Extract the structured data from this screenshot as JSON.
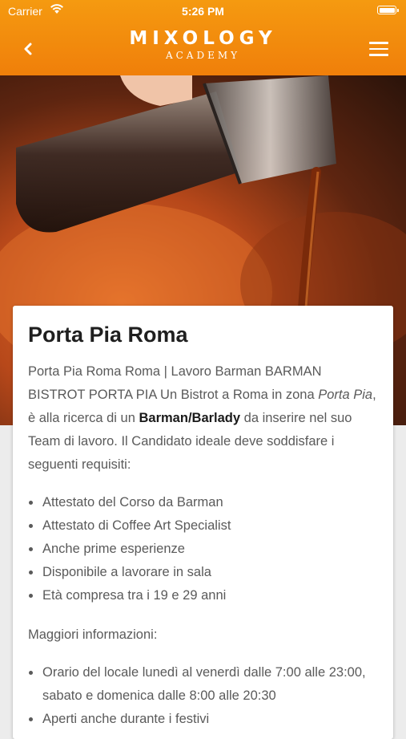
{
  "status_bar": {
    "carrier": "Carrier",
    "time": "5:26 PM"
  },
  "header": {
    "logo_main": "MIXOLOGY",
    "logo_sub": "ACADEMY",
    "back_icon": "chevron-left-icon",
    "menu_icon": "hamburger-menu-icon"
  },
  "colors": {
    "header": "#f0800a",
    "accent_text": "#1a1a1a"
  },
  "article": {
    "title": "Porta Pia Roma",
    "intro_part1": "Porta Pia Roma Roma | Lavoro Barman BARMAN BISTROT PORTA  PIA Un Bistrot a Roma in zona ",
    "intro_italic": "Porta Pia",
    "intro_part2": ", è alla ricerca di un ",
    "intro_bold": "Barman/Barlady",
    "intro_part3": " da inserire nel suo Team di lavoro. Il Candidato ideale deve soddisfare i seguenti requisiti:",
    "requirements": [
      "Attestato del Corso da Barman",
      "Attestato di Coffee Art Specialist",
      "Anche prime esperienze",
      "Disponibile a lavorare in sala",
      "Età compresa tra i 19 e 29 anni"
    ],
    "more_info_heading": "Maggiori informazioni:",
    "info_items": [
      "Orario del locale lunedì al venerdì dalle 7:00 alle 23:00, sabato e domenica dalle 8:00 alle 20:30",
      "Aperti anche durante i festivi"
    ]
  }
}
